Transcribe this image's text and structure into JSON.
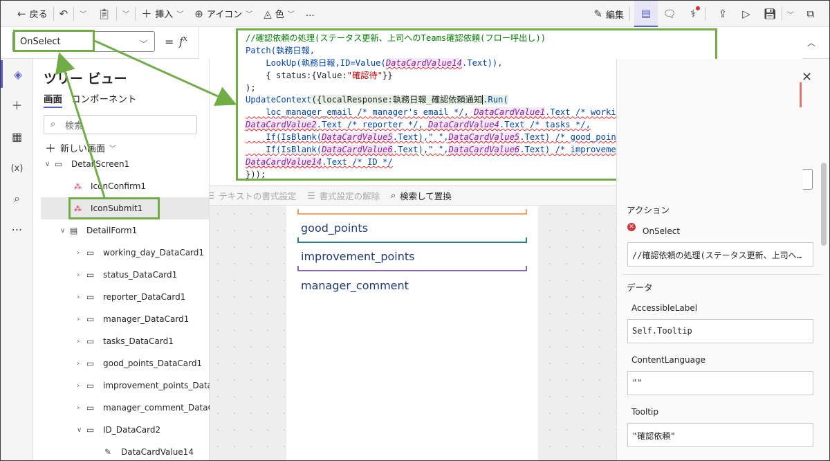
{
  "toolbar": {
    "back": "戻る",
    "insert": "挿入",
    "icon": "アイコン",
    "color": "色",
    "more": "…",
    "edit": "編集"
  },
  "formula": {
    "property": "OnSelect",
    "eq": "=",
    "fx": "fx",
    "code": {
      "l1": "//確認依頼の処理(ステータス更新、上司へのTeams確認依頼(フロー呼出し))",
      "l2_kw": "Patch",
      "l2_rest": "(執務日報,",
      "l3_a": "    LookUp(執務日報,ID=Value(",
      "l3_ctl": "DataCardValue14",
      "l3_b": ".Text)),",
      "l4_a": "    { status:{Value:",
      "l4_str": "\"確認待\"",
      "l4_b": "}}",
      "l5": ");",
      "l6_kw": "UpdateContext",
      "l6_a": "({localResponse:執務日報_確認依頼通知",
      "l6_b": ".Run(",
      "l7_a": "    loc_manager_email /* manager's email */, ",
      "l7_ctl": "DataCardValue1",
      "l7_b": ".Text /* working_day */,",
      "l8_ctl1": "DataCardValue2",
      "l8_a": ".Text /* reporter */, ",
      "l8_ctl2": "DataCardValue4",
      "l8_b": ".Text /* tasks */,",
      "l9_a": "    If(IsBlank(",
      "l9_ctl1": "DataCardValue5",
      "l9_b": ".Text),\" \",",
      "l9_ctl2": "DataCardValue5",
      "l9_c": ".Text) /* good_points */,",
      "l10_a": "    If(IsBlank(",
      "l10_ctl1": "DataCardValue6",
      "l10_b": ".Text),\" \",",
      "l10_ctl2": "DataCardValue6",
      "l10_c": ".Text) /* improvement_points */,",
      "l11_ctl": "DataCardValue14",
      "l11_a": ".Text /* ID */",
      "l12": "})); "
    },
    "format_text": "テキストの書式設定",
    "remove_format": "書式設定の解除",
    "find_replace": "検索して置換"
  },
  "tree": {
    "title": "ツリー ビュー",
    "tab_screens": "画面",
    "tab_components": "コンポーネント",
    "search_placeholder": "検索",
    "new_screen": "新しい画面",
    "nodes": [
      {
        "label": "DetailScreen1"
      },
      {
        "label": "IconConfirm1"
      },
      {
        "label": "IconSubmit1"
      },
      {
        "label": "DetailForm1"
      },
      {
        "label": "working_day_DataCard1"
      },
      {
        "label": "status_DataCard1"
      },
      {
        "label": "reporter_DataCard1"
      },
      {
        "label": "manager_DataCard1"
      },
      {
        "label": "tasks_DataCard1"
      },
      {
        "label": "good_points_DataCard1"
      },
      {
        "label": "improvement_points_DataCar"
      },
      {
        "label": "manager_comment_DataCard"
      },
      {
        "label": "ID_DataCard2"
      },
      {
        "label": "DataCardValue14"
      }
    ]
  },
  "canvas": {
    "fields": [
      "good_points",
      "improvement_points",
      "manager_comment"
    ]
  },
  "properties": {
    "action_section": "アクション",
    "onselect_label": "OnSelect",
    "onselect_value": "//確認依頼の処理(ステータス更新、上司への...",
    "data_section": "データ",
    "accessible_label": "AccessibleLabel",
    "accessible_value": "Self.Tooltip",
    "content_language": "ContentLanguage",
    "content_language_value": "\"\"",
    "tooltip_label": "Tooltip",
    "tooltip_value": "\"確認依頼\""
  },
  "colors": {
    "annotation_green": "#70ad47",
    "accent": "#5b5fc7",
    "error_red": "#d13438"
  }
}
